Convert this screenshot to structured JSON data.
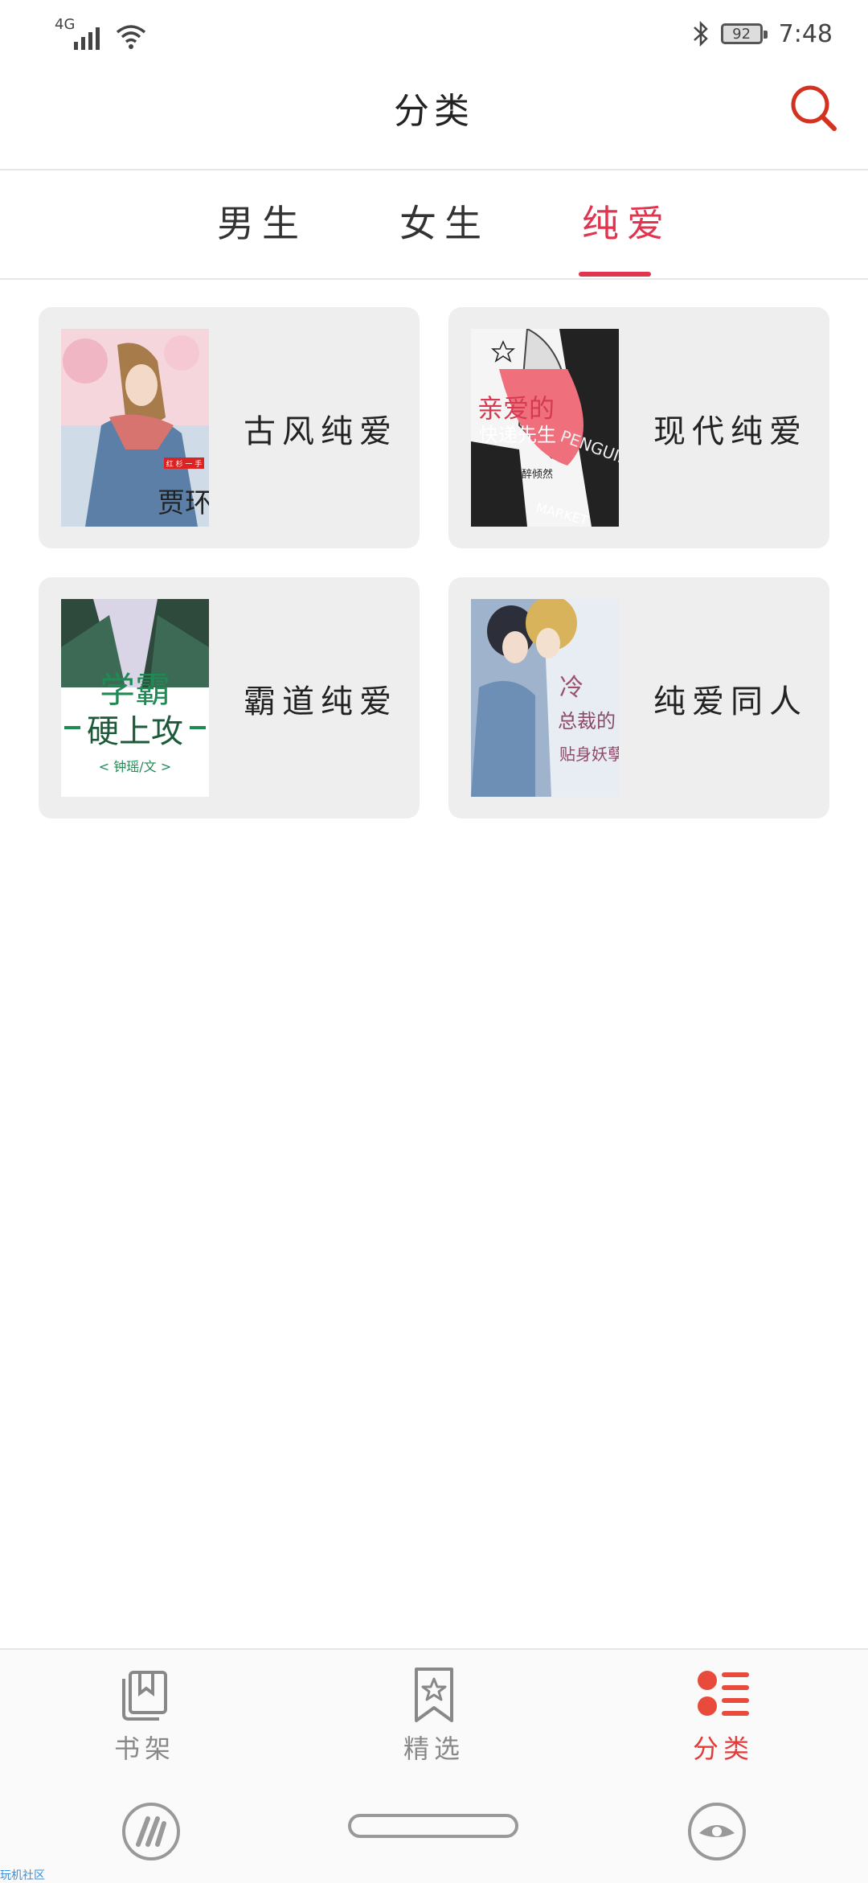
{
  "status_bar": {
    "network": "4G",
    "battery": "92",
    "time": "7:48"
  },
  "header": {
    "title": "分类",
    "search_icon": "search-icon"
  },
  "tabs": [
    {
      "label": "男生",
      "active": false
    },
    {
      "label": "女生",
      "active": false
    },
    {
      "label": "纯爱",
      "active": true
    }
  ],
  "categories": [
    {
      "label": "古风纯爱"
    },
    {
      "label": "现代纯爱"
    },
    {
      "label": "霸道纯爱"
    },
    {
      "label": "纯爱同人"
    }
  ],
  "covers": {
    "c1": {
      "line1": "红 杉 一 手",
      "line2": "贾环"
    },
    "c2": {
      "line1": "亲爱的",
      "line2": "快递先生",
      "line3": "一醉倾然",
      "side": "PENGUIN",
      "bottom": "MARKET"
    },
    "c3": {
      "line1": "学霸",
      "line2": "硬上攻",
      "line3": "< 钟瑶/文 >"
    },
    "c4": {
      "line1": "冷",
      "line2": "总裁的",
      "line3": "贴身妖孽"
    }
  },
  "bottom_nav": [
    {
      "label": "书架",
      "icon": "bookshelf-icon",
      "active": false
    },
    {
      "label": "精选",
      "icon": "bookmark-star-icon",
      "active": false
    },
    {
      "label": "分类",
      "icon": "category-list-icon",
      "active": true
    }
  ],
  "watermark": "玩机社区",
  "colors": {
    "accent": "#e0344f",
    "nav_active": "#e23b3b",
    "card_bg": "#eeeeee"
  }
}
